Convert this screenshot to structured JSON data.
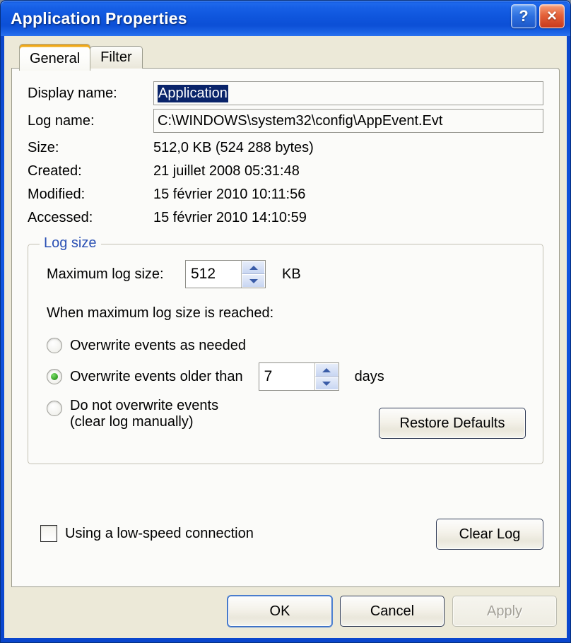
{
  "window": {
    "title": "Application Properties",
    "help_button": "?",
    "close_button": "×"
  },
  "tabs": [
    {
      "label": "General",
      "active": true
    },
    {
      "label": "Filter",
      "active": false
    }
  ],
  "general": {
    "fields": [
      {
        "label": "Display name:",
        "value": "Application",
        "type": "textbox-selected"
      },
      {
        "label": "Log name:",
        "value": "C:\\WINDOWS\\system32\\config\\AppEvent.Evt",
        "type": "textbox"
      },
      {
        "label": "Size:",
        "value": "512,0 KB (524 288 bytes)",
        "type": "static"
      },
      {
        "label": "Created:",
        "value": "21 juillet 2008 05:31:48",
        "type": "static"
      },
      {
        "label": "Modified:",
        "value": "15 février 2010 10:11:56",
        "type": "static"
      },
      {
        "label": "Accessed:",
        "value": "15 février 2010 14:10:59",
        "type": "static"
      }
    ]
  },
  "log_size_group": {
    "legend": "Log size",
    "max_log_size_label": "Maximum log size:",
    "max_log_size_value": "512",
    "max_log_size_unit": "KB",
    "when_reached_label": "When maximum log size is reached:",
    "options": [
      {
        "label": "Overwrite events as needed",
        "selected": false
      },
      {
        "label": "Overwrite events older than",
        "selected": true
      },
      {
        "label": "Do not overwrite events",
        "sublabel": "(clear log manually)",
        "selected": false
      }
    ],
    "days_value": "7",
    "days_unit": "days",
    "restore_defaults_label": "Restore Defaults"
  },
  "low_speed": {
    "label": "Using a low-speed connection",
    "checked": false
  },
  "clear_log_label": "Clear Log",
  "footer": {
    "ok_label": "OK",
    "cancel_label": "Cancel",
    "apply_label": "Apply",
    "apply_enabled": false
  },
  "colors": {
    "titlebar_blue": "#0f56dd",
    "close_red": "#c8391b",
    "tab_highlight_orange": "#f0a718",
    "legend_blue": "#2a50b4",
    "selection_blue": "#0a246a",
    "radio_green": "#3aa82c",
    "dialog_face": "#ece9d8"
  }
}
